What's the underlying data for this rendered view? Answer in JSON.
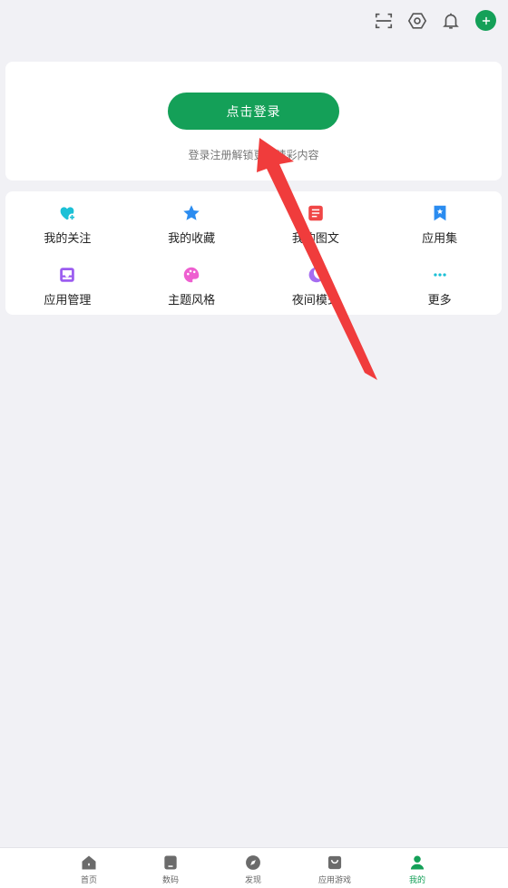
{
  "header": {
    "icons": [
      "scan-icon",
      "settings-hex-icon",
      "bell-icon",
      "plus-icon"
    ]
  },
  "login": {
    "button_label": "点击登录",
    "hint": "登录注册解锁更多精彩内容"
  },
  "features": [
    {
      "label": "我的关注",
      "icon": "heart-plus-icon",
      "color": "#1cc0d6"
    },
    {
      "label": "我的收藏",
      "icon": "star-icon",
      "color": "#2b8cf0"
    },
    {
      "label": "我的图文",
      "icon": "document-icon",
      "color": "#f04646"
    },
    {
      "label": "应用集",
      "icon": "bookmark-icon",
      "color": "#2b8cf0"
    },
    {
      "label": "应用管理",
      "icon": "inbox-icon",
      "color": "#9b5cf0"
    },
    {
      "label": "主题风格",
      "icon": "palette-icon",
      "color": "#ee5fd0"
    },
    {
      "label": "夜间模式",
      "icon": "moon-icon",
      "color": "#a56cf0"
    },
    {
      "label": "更多",
      "icon": "more-dots-icon",
      "color": "#1cc0d6"
    }
  ],
  "tabs": [
    {
      "label": "首页",
      "icon": "home-icon",
      "active": false
    },
    {
      "label": "数码",
      "icon": "device-icon",
      "active": false
    },
    {
      "label": "发现",
      "icon": "compass-icon",
      "active": false
    },
    {
      "label": "应用游戏",
      "icon": "bag-icon",
      "active": false
    },
    {
      "label": "我的",
      "icon": "user-icon",
      "active": true
    }
  ],
  "colors": {
    "accent": "#14a058",
    "background": "#f1f1f5",
    "tab_inactive": "#666666",
    "annotation_arrow": "#f03c3c"
  }
}
